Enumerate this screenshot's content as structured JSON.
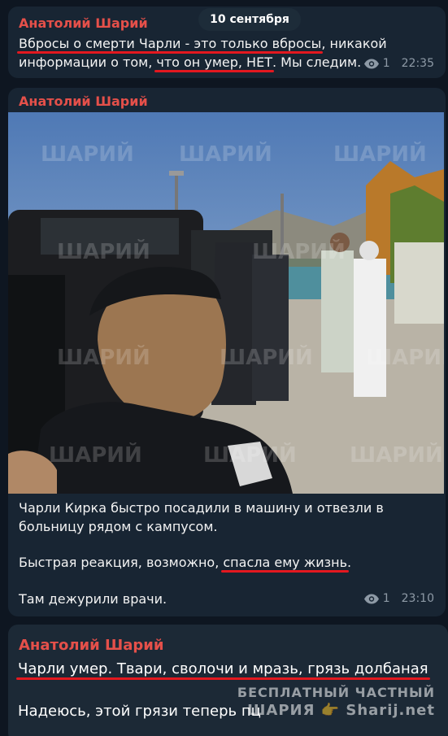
{
  "date_label": "10 сентября",
  "messages": [
    {
      "author": "Анатолий Шарий",
      "text_parts": [
        "Вбросы о смерти Чарли - это только вбросы",
        ", никакой информации о том, ",
        "что он умер, НЕТ",
        ". Мы следим."
      ],
      "views": "1",
      "time": "22:35"
    },
    {
      "author": "Анатолий Шарий",
      "video_watermark": "ШАРИЙ",
      "video_progress": 0.32,
      "caption1": "Чарли Кирка быстро посадили в машину и отвезли в больницу рядом с кампусом.",
      "caption2_before": "Быстрая реакция, возможно, ",
      "caption2_underlined": "спасла ему жизнь",
      "caption2_after": ".",
      "caption3": "Там дежурили врачи.",
      "views": "1",
      "time": "23:10"
    },
    {
      "author": "Анатолий Шарий",
      "line1": "Чарли умер. Твари, сволочи и мразь, грязь долбаная",
      "line2": "Надеюсь, этой грязи теперь пц"
    }
  ],
  "watermark": {
    "line1": "БЕСПЛАТНЫЙ ЧАСТНЫЙ",
    "line2": "ШАРИЯ 👉 Sharij.net"
  },
  "colors": {
    "background": "#0e1621",
    "bubble": "#182533",
    "author": "#e5504a",
    "underline": "#e3181f",
    "meta": "#8e9aa6"
  }
}
